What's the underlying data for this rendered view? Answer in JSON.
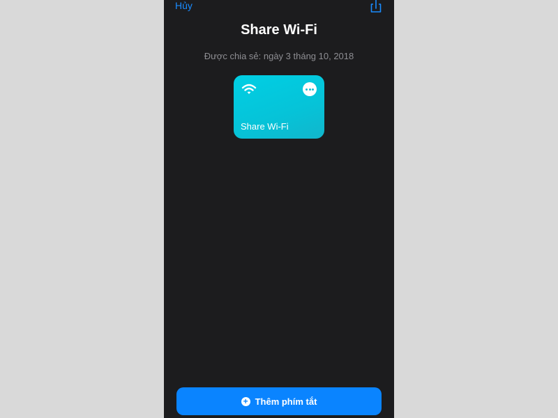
{
  "nav": {
    "cancel_label": "Hủy",
    "share_icon": "share-icon"
  },
  "header": {
    "title": "Share Wi-Fi",
    "shared_date": "Được chia sẻ: ngày 3 tháng 10, 2018"
  },
  "shortcut_card": {
    "label": "Share Wi-Fi",
    "icon": "wifi-icon",
    "more_icon": "more-icon",
    "color": "#00cfe4"
  },
  "footer": {
    "add_label": "Thêm phím tắt",
    "add_icon": "plus-circle-icon",
    "button_color": "#0a84ff"
  }
}
